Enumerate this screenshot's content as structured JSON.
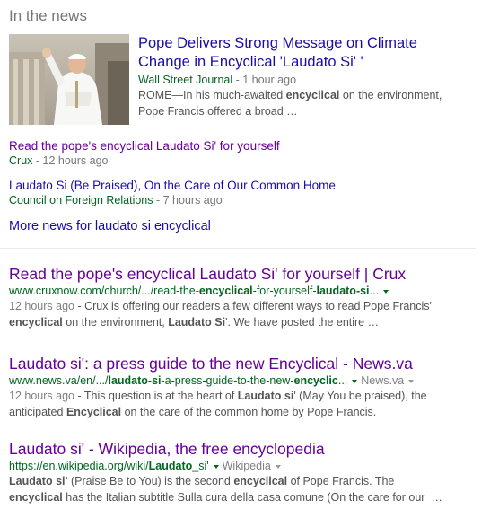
{
  "news": {
    "header": "In the news",
    "top_story": {
      "title_line1": "Pope Delivers Strong Message on Climate",
      "title_line2": "Change in Encyclical 'Laudato Si' '",
      "source": "Wall Street Journal",
      "time": " - 1 hour ago",
      "snippet_a": "ROME—In his much-awaited ",
      "snippet_b": "encyclical",
      "snippet_c": " on the environment,",
      "snippet_line2": "Pope Francis offered a broad …"
    },
    "story2": {
      "title": "Read the pope's encyclical Laudato Si' for yourself",
      "source": "Crux",
      "time": " - 12 hours ago"
    },
    "story3": {
      "title": "Laudato Si (Be Praised), On the Care of Our Common Home",
      "source": "Council on Foreign Relations",
      "time": " - 7 hours ago"
    },
    "more": "More news for laudato si encyclical"
  },
  "results": [
    {
      "title": "Read the pope's encyclical Laudato Si' for yourself | Crux",
      "url": [
        "www.cruxnow.com/church/.../read-the-",
        "encyclical",
        "-for-yourself-",
        "laudato-si",
        "..."
      ],
      "l1": [
        "12 hours ago",
        " - Crux is offering our readers a few different ways to read Pope Francis'"
      ],
      "l2": [
        "encyclical",
        " on the environment, ",
        "Laudato Si",
        "'. We have posted the entire …"
      ]
    },
    {
      "title": "Laudato si': a press guide to the new Encyclical - News.va",
      "url": [
        "www.news.va/en/.../",
        "laudato-si",
        "-a-press-guide-to-the-new-",
        "encyclic",
        "..."
      ],
      "site": "News.va",
      "l1": [
        "12 hours ago",
        " - This question is at the heart of ",
        "Laudato si",
        "' (May You be praised), the"
      ],
      "l2": [
        "anticipated ",
        "Encyclical",
        " on the care of the common home by Pope Francis."
      ]
    },
    {
      "title": "Laudato si' - Wikipedia, the free encyclopedia",
      "url": [
        "https://en.wikipedia.org/wiki/",
        "Laudato",
        "_si'"
      ],
      "site": "Wikipedia",
      "l1": [
        "Laudato si'",
        " (Praise Be to You) is the second ",
        "encyclical",
        " of Pope Francis. The"
      ],
      "l2": [
        "encyclical",
        " has the Italian subtitle Sulla cura della casa comune (On the care for our  …"
      ]
    }
  ],
  "colors": {
    "title_blue": "#1a0dab",
    "visited": "#660099",
    "url_green": "#006621",
    "snippet_grey": "#545454"
  }
}
